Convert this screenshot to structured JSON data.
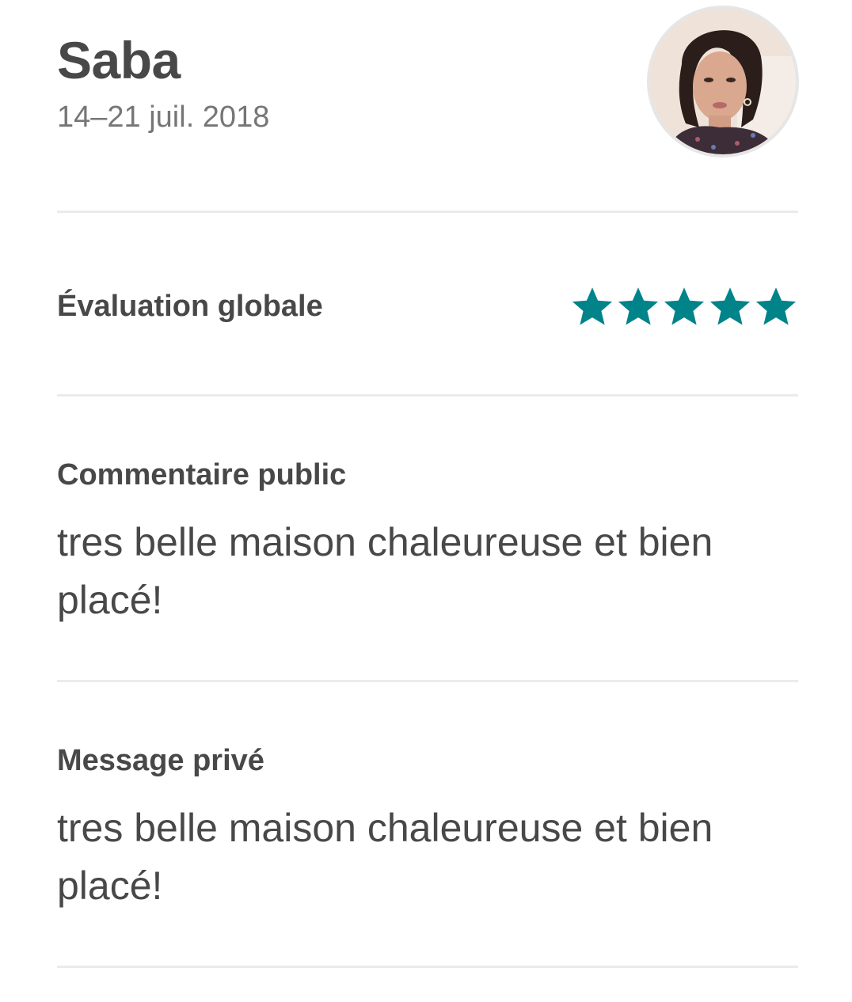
{
  "reviewer": {
    "name": "Saba",
    "dates": "14–21 juil. 2018",
    "avatar_icon": "user-photo"
  },
  "overall_rating": {
    "label": "Évaluation globale",
    "stars": 5,
    "max_stars": 5,
    "star_color": "#008489"
  },
  "public_comment": {
    "title": "Commentaire public",
    "text": "tres belle maison chaleureuse et bien placé!"
  },
  "private_message": {
    "title": "Message privé",
    "text": "tres belle maison chaleureuse et bien placé!"
  }
}
